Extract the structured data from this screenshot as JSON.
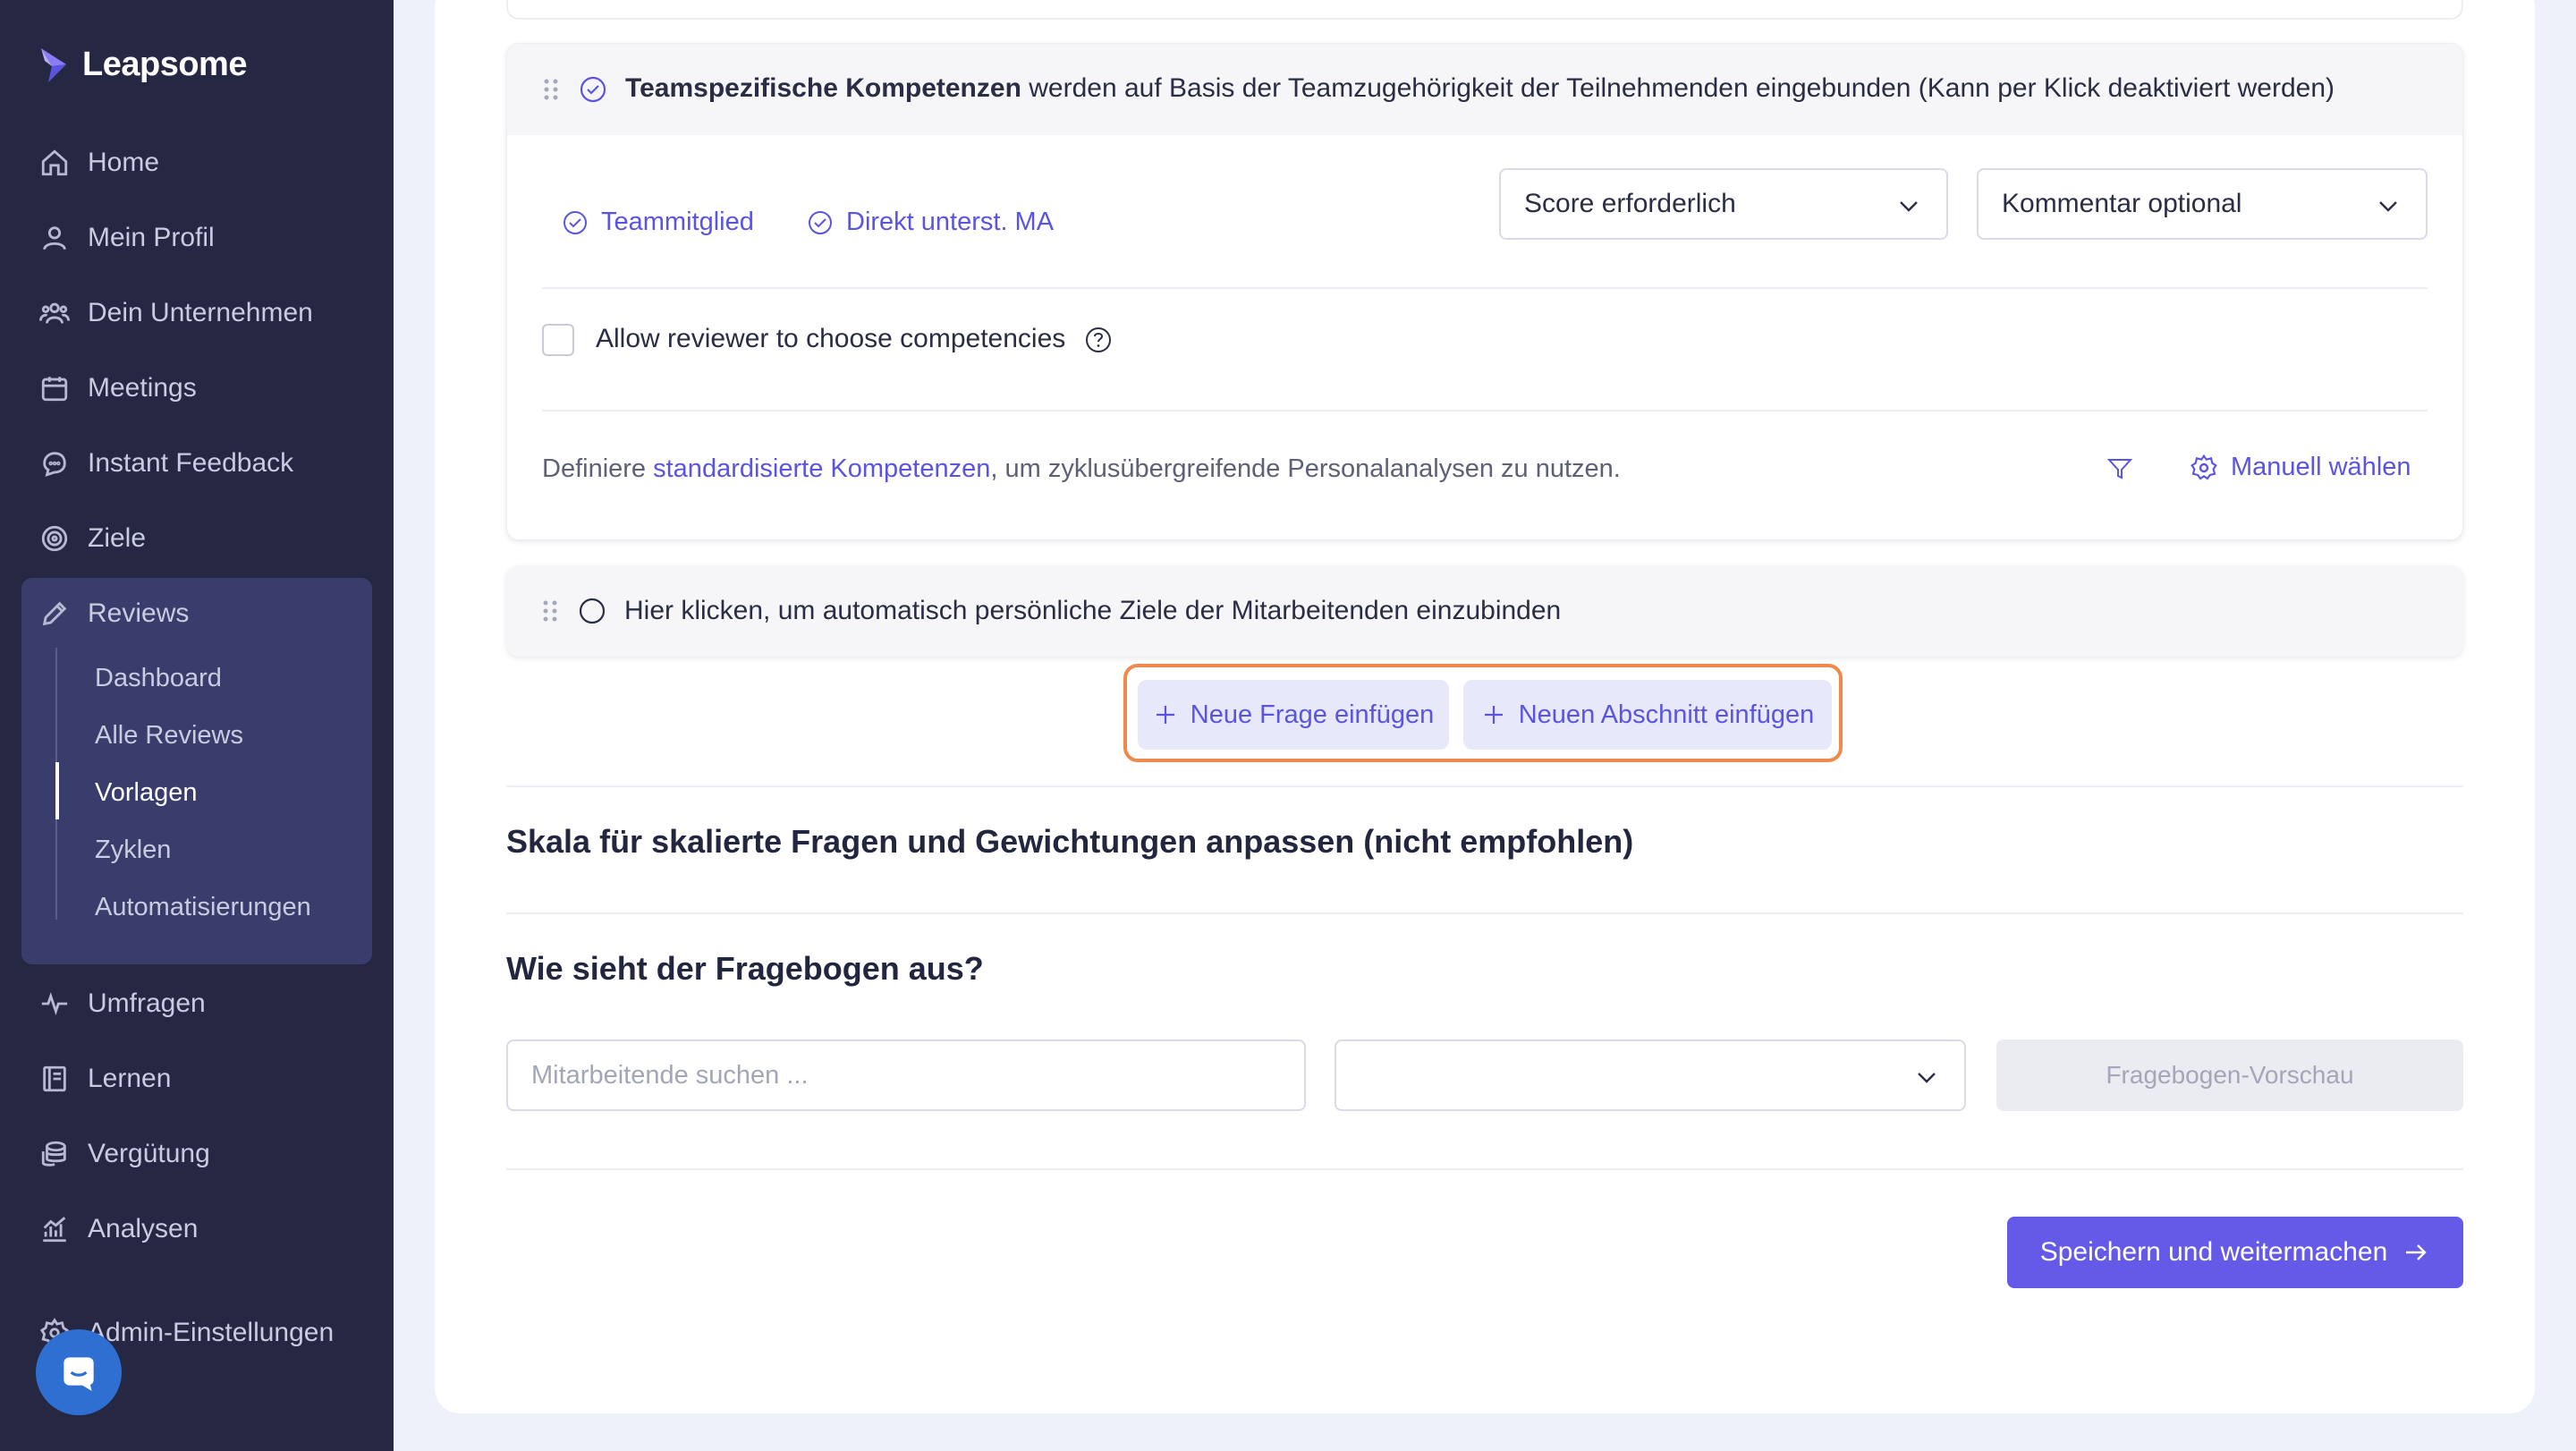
{
  "app": {
    "brand": "Leapsome"
  },
  "sidebar": {
    "items": [
      {
        "label": "Home",
        "icon": "home-icon"
      },
      {
        "label": "Mein Profil",
        "icon": "user-icon"
      },
      {
        "label": "Dein Unternehmen",
        "icon": "users-icon"
      },
      {
        "label": "Meetings",
        "icon": "calendar-icon"
      },
      {
        "label": "Instant Feedback",
        "icon": "chat-icon"
      },
      {
        "label": "Ziele",
        "icon": "target-icon"
      },
      {
        "label": "Reviews",
        "icon": "pencil-icon"
      },
      {
        "label": "Umfragen",
        "icon": "pulse-icon"
      },
      {
        "label": "Lernen",
        "icon": "book-icon"
      },
      {
        "label": "Vergütung",
        "icon": "coins-icon"
      },
      {
        "label": "Analysen",
        "icon": "chart-icon"
      },
      {
        "label": "Admin-Einstellungen",
        "icon": "gear-icon"
      }
    ],
    "reviews_sub": [
      "Dashboard",
      "Alle Reviews",
      "Vorlagen",
      "Zyklen",
      "Automatisierungen"
    ],
    "active_sub": "Vorlagen"
  },
  "team_section": {
    "title_bold": "Teamspezifische Kompetenzen",
    "title_rest": " werden auf Basis der Teamzugehörigkeit der Teilnehmenden eingebunden (Kann per Klick deaktiviert werden)",
    "chip_1": "Teammitglied",
    "chip_2": "Direkt unterst. MA",
    "score_select": "Score erforderlich",
    "comment_select": "Kommentar optional",
    "allow_reviewer": "Allow reviewer to choose competencies",
    "define_prefix": "Definiere ",
    "define_link": "standardisierte Kompetenzen",
    "define_suffix": ", um zyklusübergreifende Personalanalysen zu nutzen.",
    "manual_select": "Manuell wählen"
  },
  "goals_section": {
    "text": "Hier klicken, um automatisch persönliche Ziele der Mitarbeitenden einzubinden"
  },
  "actions": {
    "new_question": "Neue Frage einfügen",
    "new_section": "Neuen Abschnitt einfügen"
  },
  "scale_heading": "Skala für skalierte Fragen und Gewichtungen anpassen (nicht empfohlen)",
  "preview": {
    "heading": "Wie sieht der Fragebogen aus?",
    "search_placeholder": "Mitarbeitende suchen ...",
    "select_value": "",
    "preview_button": "Fragebogen-Vorschau"
  },
  "save_button": "Speichern und weitermachen",
  "colors": {
    "sidebar_bg": "#262843",
    "accent": "#5b54e0",
    "primary_button": "#6559e8",
    "highlight": "#ef8a4c"
  }
}
